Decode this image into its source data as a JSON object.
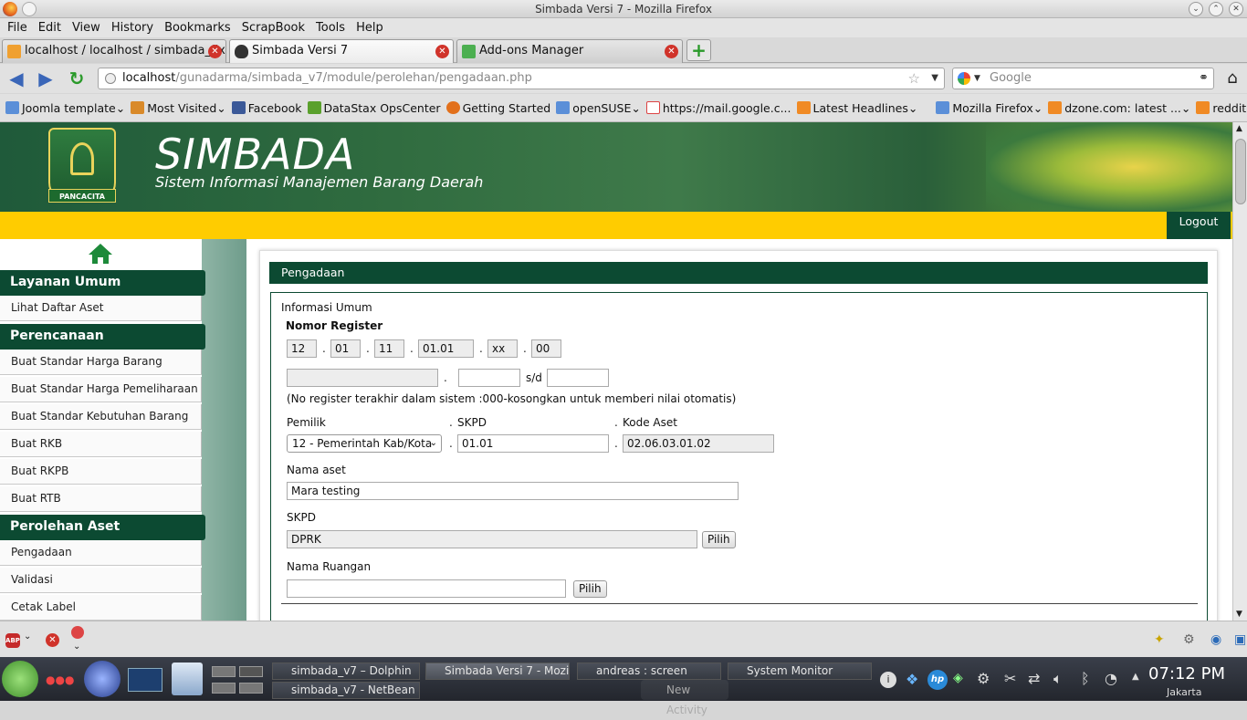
{
  "window": {
    "title": "Simbada Versi 7 - Mozilla Firefox"
  },
  "menu": [
    "File",
    "Edit",
    "View",
    "History",
    "Bookmarks",
    "ScrapBook",
    "Tools",
    "Help"
  ],
  "tabs": [
    {
      "label": "localhost / localhost / simbada_fix..."
    },
    {
      "label": "Simbada Versi 7"
    },
    {
      "label": "Add-ons Manager"
    }
  ],
  "nav": {
    "url_host": "localhost",
    "url_path": "/gunadarma/simbada_v7/module/perolehan/pengadaan.php",
    "search_placeholder": "Google"
  },
  "bookmarks": [
    {
      "label": "Joomla template",
      "dropdown": true
    },
    {
      "label": "Most Visited",
      "dropdown": true
    },
    {
      "label": "Facebook"
    },
    {
      "label": "DataStax OpsCenter"
    },
    {
      "label": "Getting Started"
    },
    {
      "label": "openSUSE",
      "dropdown": true
    },
    {
      "label": "https://mail.google.c..."
    },
    {
      "label": "Latest Headlines",
      "dropdown": true
    },
    {
      "label": "Mozilla Firefox",
      "dropdown": true
    },
    {
      "label": "dzone.com: latest ...",
      "dropdown": true
    },
    {
      "label": "reddit",
      "dropdown": true
    }
  ],
  "header": {
    "emblem_label": "PANCACITA",
    "brand": "SIMBADA",
    "tagline": "Sistem Informasi Manajemen Barang Daerah",
    "logout": "Logout"
  },
  "sidebar": {
    "sections": [
      {
        "title": "Layanan Umum",
        "items": [
          "Lihat Daftar Aset"
        ]
      },
      {
        "title": "Perencanaan",
        "items": [
          "Buat Standar Harga Barang",
          "Buat Standar Harga Pemeliharaan",
          "Buat Standar Kebutuhan Barang",
          "Buat RKB",
          "Buat RKPB",
          "Buat RTB"
        ]
      },
      {
        "title": "Perolehan Aset",
        "items": [
          "Pengadaan",
          "Validasi",
          "Cetak Label"
        ]
      }
    ]
  },
  "form": {
    "panel_title": "Pengadaan",
    "section_title": "Informasi Umum",
    "nomor_register_label": "Nomor Register",
    "register_parts": [
      "12",
      "01",
      "11",
      "01.01",
      "xx",
      "00"
    ],
    "sd_label": "s/d",
    "register_note": "(No register terakhir dalam sistem :000-kosongkan untuk memberi nilai otomatis)",
    "pemilik_label": "Pemilik",
    "pemilik_value": "12 - Pemerintah Kab/Kota",
    "skpd_code_label": "SKPD",
    "skpd_code_value": "01.01",
    "kode_aset_label": "Kode Aset",
    "kode_aset_value": "02.06.03.01.02",
    "nama_aset_label": "Nama aset",
    "nama_aset_value": "Mara testing",
    "skpd_label": "SKPD",
    "skpd_value": "DPRK",
    "pilih_label": "Pilih",
    "nama_ruangan_label": "Nama Ruangan",
    "nama_ruangan_value": ""
  },
  "taskbar": {
    "tasks": [
      "simbada_v7 – Dolphin",
      "Simbada Versi 7 - Mozi",
      "andreas : screen",
      "System Monitor",
      "simbada_v7 - NetBean"
    ],
    "activity": "New Activity",
    "clock": "07:12 PM",
    "timezone": "Jakarta"
  }
}
